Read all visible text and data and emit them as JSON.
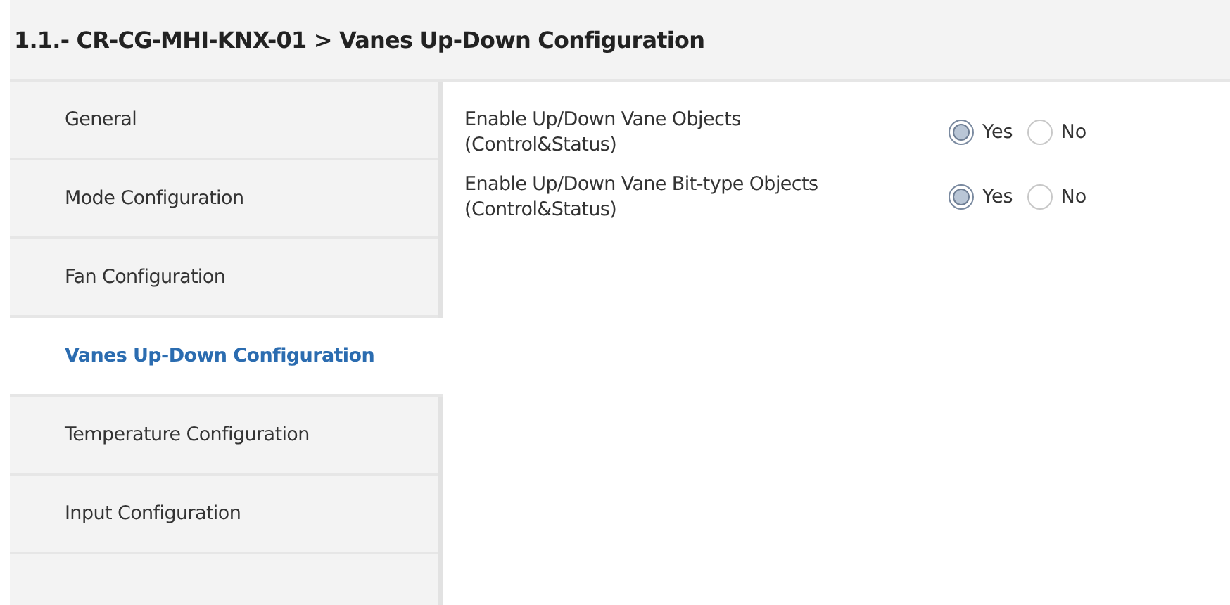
{
  "header": {
    "title": "1.1.- CR-CG-MHI-KNX-01 > Vanes Up-Down Configuration"
  },
  "sidebar": {
    "items": [
      {
        "label": "General",
        "selected": false
      },
      {
        "label": "Mode Configuration",
        "selected": false
      },
      {
        "label": "Fan Configuration",
        "selected": false
      },
      {
        "label": "Vanes Up-Down Configuration",
        "selected": true
      },
      {
        "label": "Temperature Configuration",
        "selected": false
      },
      {
        "label": "Input Configuration",
        "selected": false
      }
    ]
  },
  "parameters": [
    {
      "label": "Enable Up/Down Vane Objects\n(Control&Status)",
      "options": [
        {
          "label": "Yes",
          "selected": true
        },
        {
          "label": "No",
          "selected": false
        }
      ]
    },
    {
      "label": "Enable Up/Down Vane Bit-type Objects\n(Control&Status)",
      "options": [
        {
          "label": "Yes",
          "selected": true
        },
        {
          "label": "No",
          "selected": false
        }
      ]
    }
  ]
}
